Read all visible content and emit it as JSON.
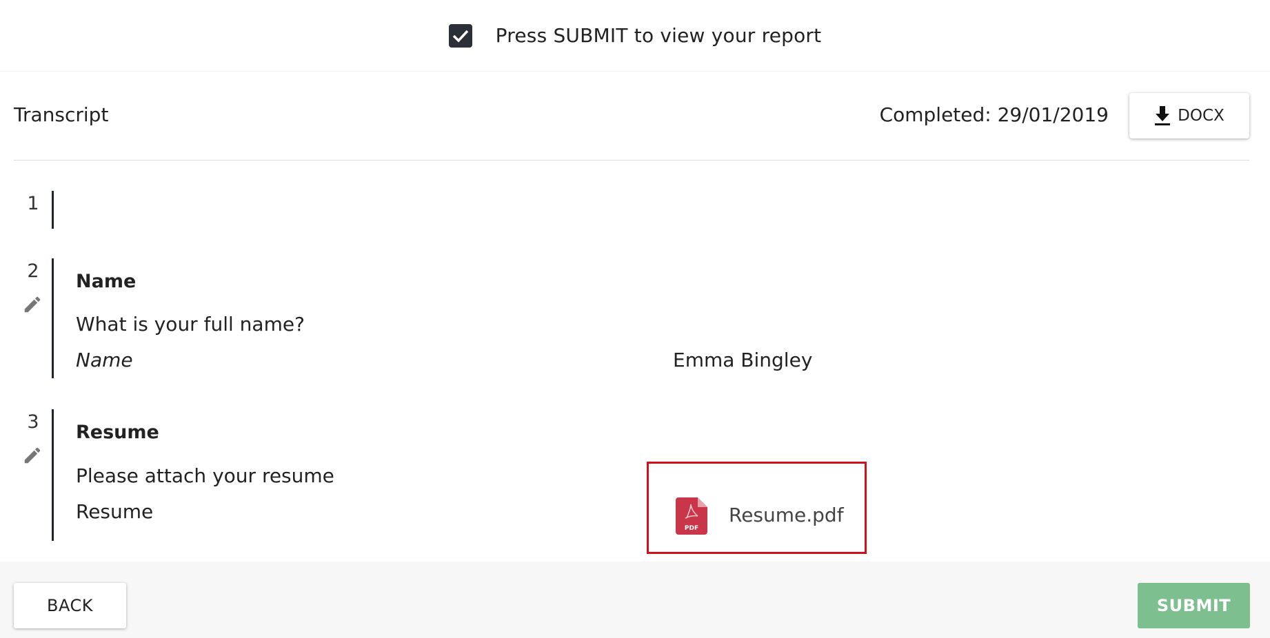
{
  "banner": {
    "checked": true,
    "text": "Press SUBMIT to view your report"
  },
  "transcript": {
    "title": "Transcript",
    "completed": "Completed: 29/01/2019",
    "docx_label": "DOCX"
  },
  "questions": [
    {
      "number": "1"
    },
    {
      "number": "2",
      "title": "Name",
      "text": "What is your full name?",
      "field_label": "Name",
      "answer": "Emma Bingley"
    },
    {
      "number": "3",
      "title": "Resume",
      "text": "Please attach your resume",
      "field_label": "Resume",
      "attachment": "Resume.pdf",
      "attachment_badge": "PDF"
    }
  ],
  "footer": {
    "back_label": "BACK",
    "submit_label": "SUBMIT"
  },
  "colors": {
    "submit_bg": "#7dbf8e",
    "highlight_border": "#d0101c",
    "pdf_icon": "#c9364a",
    "bar": "#1e2430"
  }
}
